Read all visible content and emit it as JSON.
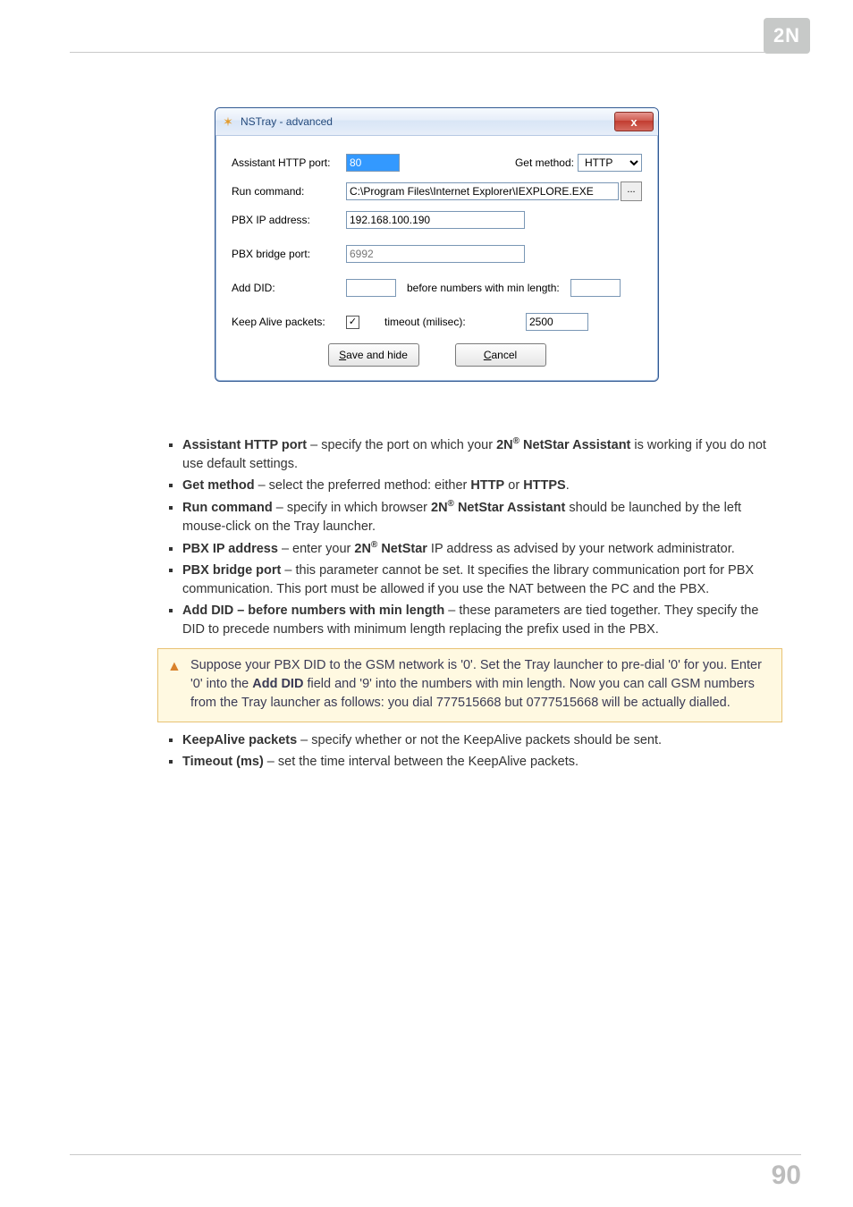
{
  "logo": "2N",
  "dialog": {
    "title": "NSTray - advanced",
    "close_x": "x",
    "labels": {
      "http_port": "Assistant HTTP port:",
      "get_method": "Get method:",
      "run_cmd": "Run command:",
      "pbx_ip": "PBX IP address:",
      "pbx_bridge": "PBX bridge port:",
      "add_did": "Add DID:",
      "before_numbers": "before numbers with min length:",
      "keep_alive": "Keep Alive packets:",
      "timeout": "timeout (milisec):"
    },
    "values": {
      "http_port": "80",
      "get_method": "HTTP",
      "run_cmd": "C:\\Program Files\\Internet Explorer\\IEXPLORE.EXE",
      "pbx_ip": "192.168.100.190",
      "pbx_bridge": "6992",
      "add_did": "",
      "min_length": "",
      "keep_alive_checked": "✓",
      "timeout": "2500"
    },
    "buttons": {
      "save_pre": "S",
      "save_rest": "ave and hide",
      "cancel_pre": "C",
      "cancel_rest": "ancel",
      "browse": "..."
    }
  },
  "doc": {
    "items1": [
      {
        "term": "Assistant HTTP port",
        "rest": " – specify the port on which your ",
        "prod": "2N",
        "sup": "®",
        "prod2": " NetStar Assistant",
        "tail": " is working if you do not use default settings."
      },
      {
        "term": "Get method",
        "rest": " – select the preferred method: either ",
        "b2": "HTTP",
        "mid": " or ",
        "b3": "HTTPS",
        "tail": "."
      },
      {
        "term": "Run command",
        "rest": " – specify in which browser ",
        "prod": "2N",
        "sup": "®",
        "prod2": " NetStar Assistant",
        "tail": " should be launched by the left mouse-click on the Tray launcher."
      },
      {
        "term": "PBX IP address",
        "rest": " – enter your ",
        "prod": "2N",
        "sup": "®",
        "prod2": " NetStar",
        "tail": " IP address as advised by your network administrator."
      },
      {
        "term": "PBX bridge port",
        "rest": " – this parameter cannot be set. It specifies the library communication port for PBX communication. This port must be allowed if you use the NAT between the PC and the PBX."
      },
      {
        "term": "Add DID – before numbers with min length",
        "rest": " – these parameters are tied together. They specify the DID to precede numbers with minimum length replacing the prefix used in the PBX."
      }
    ],
    "note_pre": "Suppose your PBX DID to the GSM network is '0'. Set the Tray launcher to pre-dial '0' for you. Enter '0' into the ",
    "note_b": "Add DID",
    "note_post": " field and '9' into the numbers with min length. Now you can call GSM numbers from the Tray launcher as follows: you dial 777515668 but 0777515668 will be actually dialled.",
    "items2": [
      {
        "term": "KeepAlive packets",
        "rest": " – specify whether or not the KeepAlive packets should be sent."
      },
      {
        "term": "Timeout (ms)",
        "rest": " – set the time interval between the KeepAlive packets."
      }
    ]
  },
  "page_number": "90"
}
